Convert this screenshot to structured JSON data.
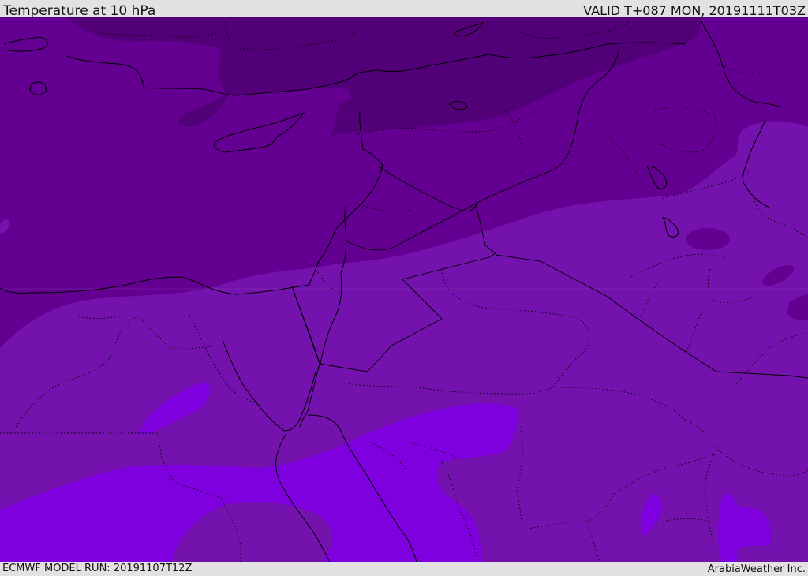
{
  "header": {
    "title": "Temperature at 10 hPa",
    "valid_time": "VALID T+087 MON, 20191111T03Z"
  },
  "footer": {
    "model_run": "ECMWF MODEL RUN: 20191107T12Z",
    "credit": "ArabiaWeather Inc."
  },
  "map": {
    "field": "temperature",
    "level": "10 hPa",
    "colors": {
      "darkest": "#510078",
      "dark": "#640091",
      "medium": "#7412ad",
      "light": "#7e00de",
      "border": "#000000"
    }
  }
}
